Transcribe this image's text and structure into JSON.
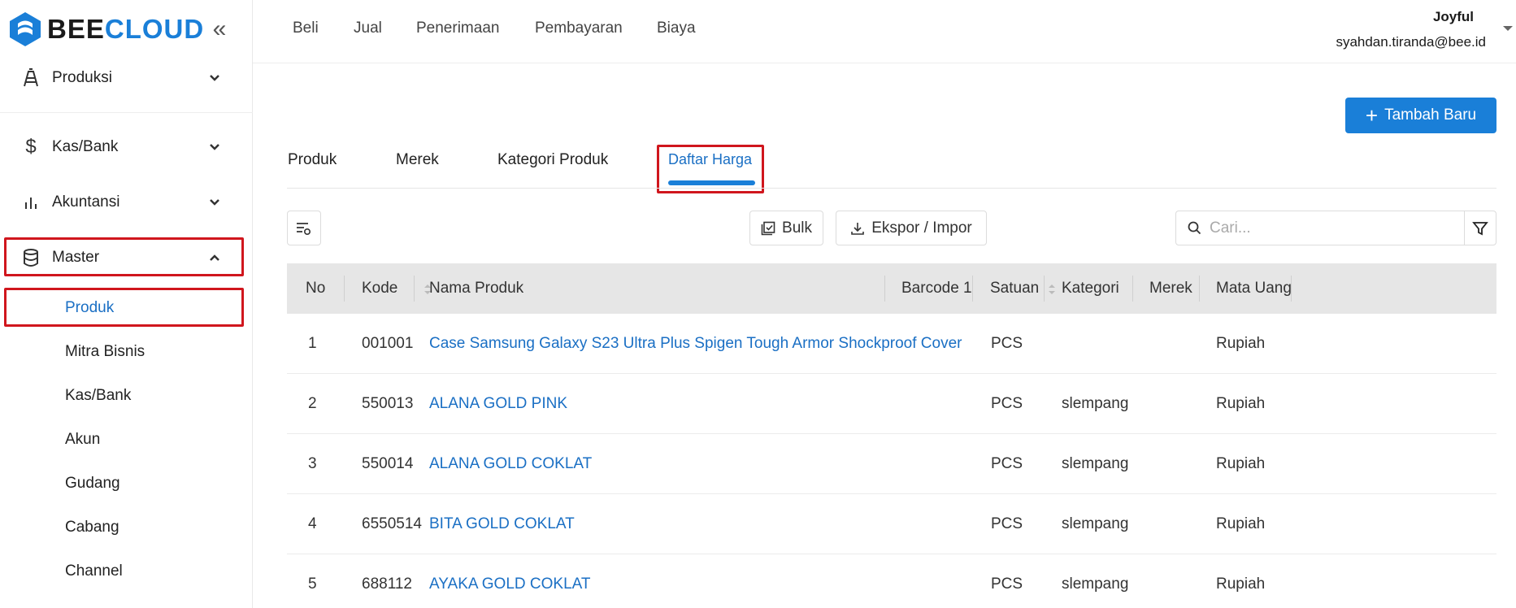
{
  "brand": {
    "logo_text_a": "BEE",
    "logo_text_b": "CLOUD",
    "brand_color": "#1a7fd8"
  },
  "sidebar": {
    "groups": [
      {
        "label": "Produksi",
        "icon": "factory-icon"
      },
      {
        "label": "Kas/Bank",
        "icon": "dollar-icon"
      },
      {
        "label": "Akuntansi",
        "icon": "bar-chart-icon"
      },
      {
        "label": "Master",
        "icon": "database-icon",
        "expanded": true
      }
    ],
    "sub_items": [
      {
        "label": "Produk",
        "active": true
      },
      {
        "label": "Mitra Bisnis"
      },
      {
        "label": "Kas/Bank"
      },
      {
        "label": "Akun"
      },
      {
        "label": "Gudang"
      },
      {
        "label": "Cabang"
      },
      {
        "label": "Channel"
      }
    ]
  },
  "topbar": {
    "nav": [
      "Beli",
      "Jual",
      "Penerimaan",
      "Pembayaran",
      "Biaya"
    ],
    "user_name": "Joyful",
    "user_email": "syahdan.tiranda@bee.id"
  },
  "main": {
    "add_button": "Tambah Baru",
    "tabs": [
      {
        "label": "Produk"
      },
      {
        "label": "Merek"
      },
      {
        "label": "Kategori Produk"
      },
      {
        "label": "Daftar Harga",
        "active": true
      }
    ],
    "toolbar": {
      "bulk_label": "Bulk",
      "export_label": "Ekspor / Impor",
      "search_placeholder": "Cari..."
    },
    "table": {
      "columns": [
        "No",
        "Kode",
        "Nama Produk",
        "Barcode 1",
        "Satuan",
        "Kategori",
        "Merek",
        "Mata Uang"
      ],
      "rows": [
        {
          "no": "1",
          "kode": "001001",
          "nama": "Case Samsung Galaxy S23 Ultra Plus Spigen Tough Armor Shockproof Cover",
          "barcode": "",
          "satuan": "PCS",
          "kategori": "",
          "merek": "",
          "mata_uang": "Rupiah"
        },
        {
          "no": "2",
          "kode": "550013",
          "nama": "ALANA GOLD PINK",
          "barcode": "",
          "satuan": "PCS",
          "kategori": "slempang",
          "merek": "",
          "mata_uang": "Rupiah"
        },
        {
          "no": "3",
          "kode": "550014",
          "nama": "ALANA GOLD COKLAT",
          "barcode": "",
          "satuan": "PCS",
          "kategori": "slempang",
          "merek": "",
          "mata_uang": "Rupiah"
        },
        {
          "no": "4",
          "kode": "6550514",
          "nama": "BITA GOLD COKLAT",
          "barcode": "",
          "satuan": "PCS",
          "kategori": "slempang",
          "merek": "",
          "mata_uang": "Rupiah"
        },
        {
          "no": "5",
          "kode": "688112",
          "nama": "AYAKA GOLD COKLAT",
          "barcode": "",
          "satuan": "PCS",
          "kategori": "slempang",
          "merek": "",
          "mata_uang": "Rupiah"
        }
      ]
    }
  },
  "highlight_color": "#d0161d"
}
